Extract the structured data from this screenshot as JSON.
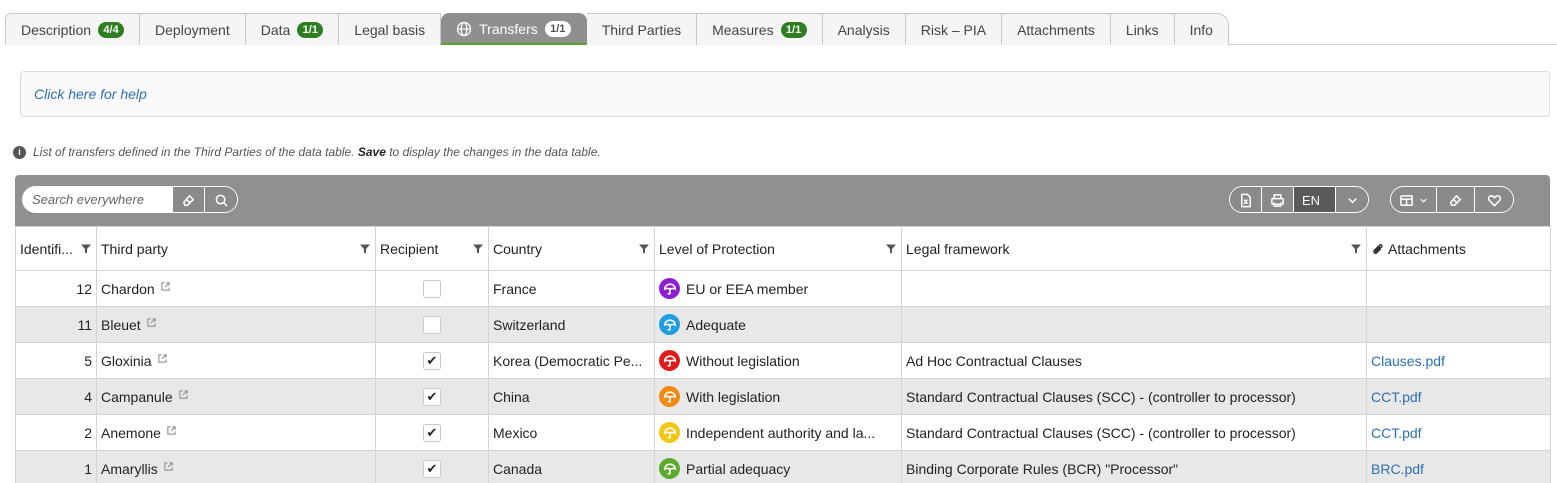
{
  "tabs": [
    {
      "label": "Description",
      "badge": "4/4"
    },
    {
      "label": "Deployment",
      "badge": ""
    },
    {
      "label": "Data",
      "badge": "1/1"
    },
    {
      "label": "Legal basis",
      "badge": ""
    },
    {
      "label": "Transfers",
      "badge": "1/1",
      "active": true,
      "icon": "globe-icon"
    },
    {
      "label": "Third Parties",
      "badge": ""
    },
    {
      "label": "Measures",
      "badge": "1/1"
    },
    {
      "label": "Analysis",
      "badge": ""
    },
    {
      "label": "Risk – PIA",
      "badge": ""
    },
    {
      "label": "Attachments",
      "badge": ""
    },
    {
      "label": "Links",
      "badge": ""
    },
    {
      "label": "Info",
      "badge": ""
    }
  ],
  "help": {
    "text": "Click here for help"
  },
  "info": {
    "prefix": "List of transfers defined in the Third Parties of the data table. ",
    "bold": "Save",
    "suffix": " to display the changes in the data table."
  },
  "toolbar": {
    "search_placeholder": "Search everywhere",
    "lang": "EN"
  },
  "columns": [
    "Identifi...",
    "Third party",
    "Recipient",
    "Country",
    "Level of Protection",
    "Legal framework",
    "Attachments"
  ],
  "rows": [
    {
      "id": "12",
      "party": "Chardon",
      "recipient": false,
      "country": "France",
      "level": "EU or EEA member",
      "level_color": "#8e1fd1",
      "framework": "",
      "attachment": ""
    },
    {
      "id": "11",
      "party": "Bleuet",
      "recipient": false,
      "country": "Switzerland",
      "level": "Adequate",
      "level_color": "#1e9ee0",
      "framework": "",
      "attachment": ""
    },
    {
      "id": "5",
      "party": "Gloxinia",
      "recipient": true,
      "country": "Korea (Democratic Pe...",
      "level": "Without legislation",
      "level_color": "#e01b1b",
      "framework": "Ad Hoc Contractual Clauses",
      "attachment": "Clauses.pdf"
    },
    {
      "id": "4",
      "party": "Campanule",
      "recipient": true,
      "country": "China",
      "level": "With legislation",
      "level_color": "#f08a12",
      "framework": "Standard Contractual Clauses (SCC) - (controller to processor)",
      "attachment": "CCT.pdf"
    },
    {
      "id": "2",
      "party": "Anemone",
      "recipient": true,
      "country": "Mexico",
      "level": "Independent authority and la...",
      "level_color": "#f2c612",
      "framework": "Standard Contractual Clauses (SCC) - (controller to processor)",
      "attachment": "CCT.pdf"
    },
    {
      "id": "1",
      "party": "Amaryllis",
      "recipient": true,
      "country": "Canada",
      "level": "Partial adequacy",
      "level_color": "#5aab2e",
      "framework": "Binding Corporate Rules (BCR) \"Processor\"",
      "attachment": "BRC.pdf"
    }
  ]
}
